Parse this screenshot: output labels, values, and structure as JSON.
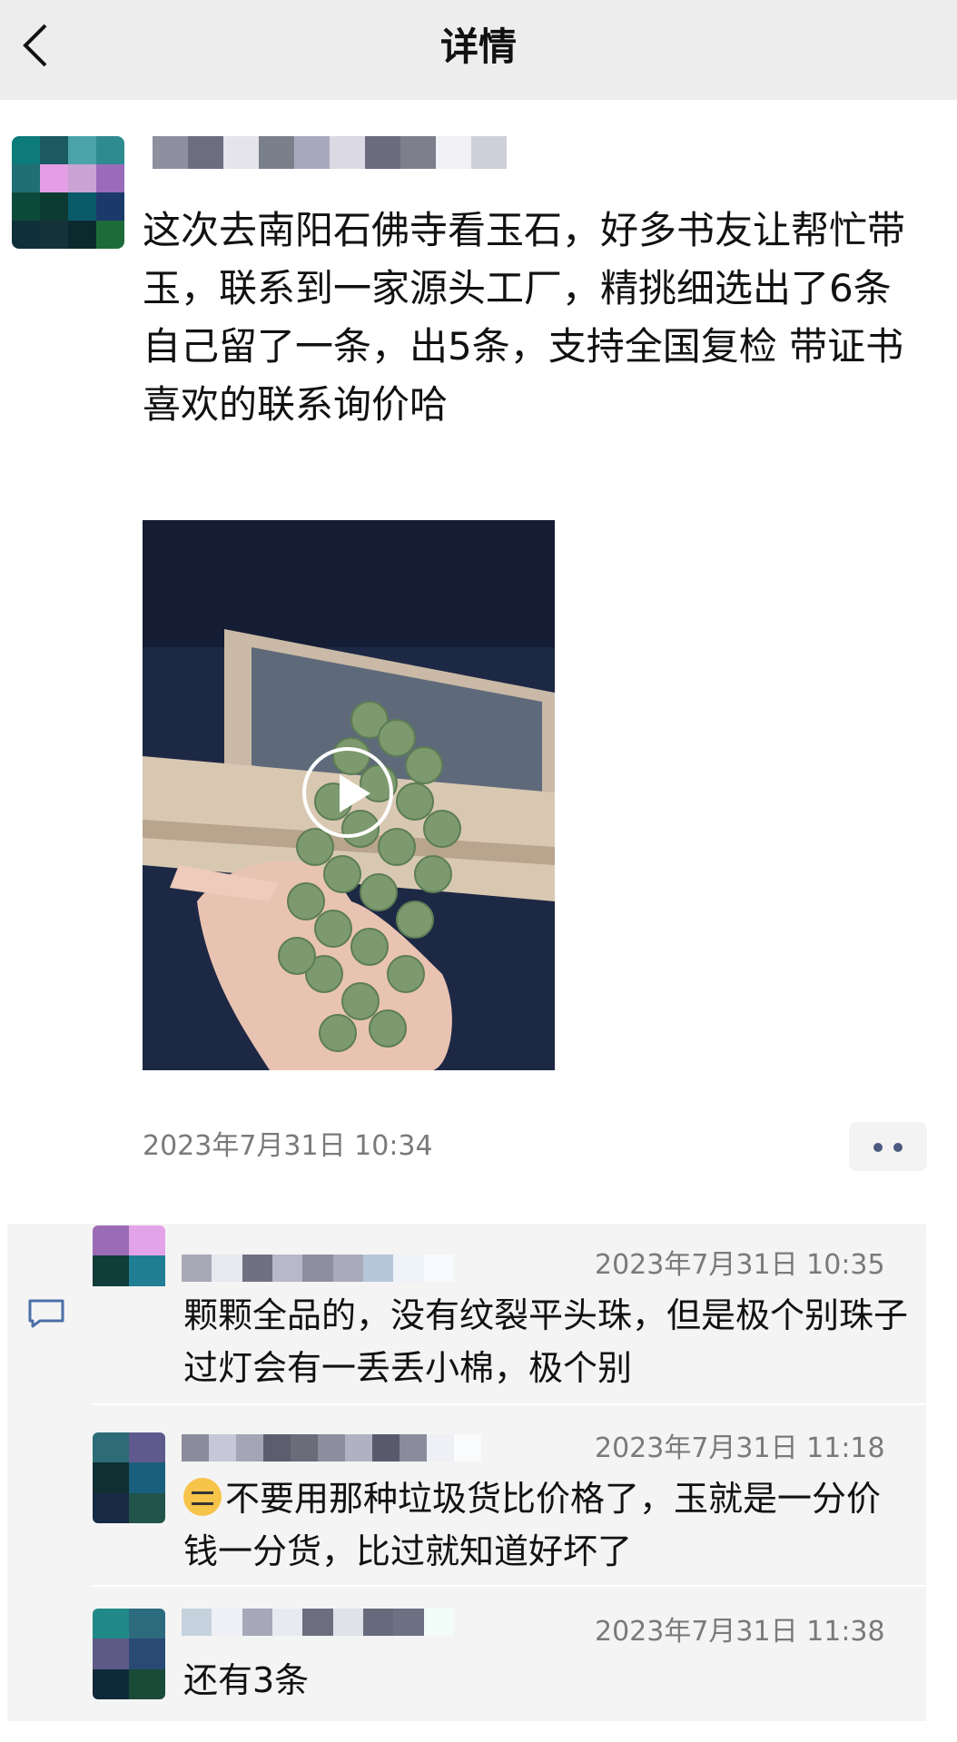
{
  "header": {
    "title": "详情"
  },
  "post": {
    "text": "这次去南阳石佛寺看玉石，好多书友让帮忙带玉，联系到一家源头工厂，精挑细选出了6条自己留了一条，出5条，支持全国复检 带证书\n喜欢的联系询价哈",
    "timestamp": "2023年7月31日 10:34"
  },
  "comments": [
    {
      "time": "2023年7月31日 10:35",
      "text": "颗颗全品的，没有纹裂平头珠，但是极个别珠子过灯会有一丢丢小棉，极个别"
    },
    {
      "time": "2023年7月31日 11:18",
      "emoji": "sweat-smile-emoji",
      "text": "不要用那种垃圾货比价格了，玉就是一分价钱一分货，比过就知道好坏了"
    },
    {
      "time": "2023年7月31日 11:38",
      "text": "还有3条"
    }
  ],
  "colors": {
    "header_bg": "#ededed",
    "comment_bg": "#f4f4f4",
    "timestamp": "#7a7a7a",
    "accent": "#4b5a7f"
  }
}
